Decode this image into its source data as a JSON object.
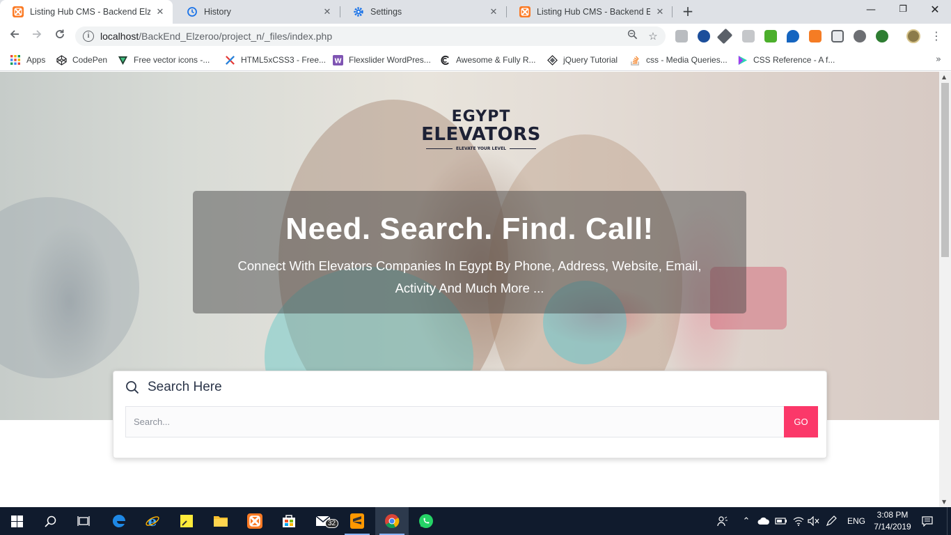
{
  "browser": {
    "tabs": [
      {
        "title": "Listing Hub CMS - Backend Elzeroo",
        "icon": "xampp-icon",
        "active": true
      },
      {
        "title": "History",
        "icon": "history-icon",
        "active": false
      },
      {
        "title": "Settings",
        "icon": "gear-icon",
        "active": false
      },
      {
        "title": "Listing Hub CMS - Backend Elzeroo",
        "icon": "xampp-icon",
        "active": false
      }
    ],
    "url_host": "localhost",
    "url_path": "/BackEnd_Elzeroo/project_n/_files/index.php",
    "bookmarks": [
      {
        "label": "Apps",
        "icon": "apps-grid-icon"
      },
      {
        "label": "CodePen",
        "icon": "codepen-icon"
      },
      {
        "label": "Free vector icons -...",
        "icon": "vector-icon"
      },
      {
        "label": "HTML5xCSS3 - Free...",
        "icon": "x-icon"
      },
      {
        "label": "Flexslider WordPres...",
        "icon": "woo-icon"
      },
      {
        "label": "Awesome & Fully R...",
        "icon": "swirl-icon"
      },
      {
        "label": "jQuery Tutorial",
        "icon": "diamond-icon"
      },
      {
        "label": "css - Media Queries...",
        "icon": "stackoverflow-icon"
      },
      {
        "label": "CSS Reference - A f...",
        "icon": "play-icon"
      }
    ]
  },
  "page": {
    "logo": {
      "line1": "EGYPT",
      "line2": "ELEVATORS",
      "tagline": "ELEVATE YOUR LEVEL"
    },
    "hero": {
      "headline": "Need. Search. Find. Call!",
      "subtitle": "Connect With Elevators Companies In Egypt By Phone, Address, Website, Email, Activity And Much More ..."
    },
    "search": {
      "title": "Search Here",
      "placeholder": "Search...",
      "button": "GO"
    },
    "colors": {
      "accent": "#fb3869",
      "brand_dark": "#1d2135"
    }
  },
  "taskbar": {
    "mail_badge": "32",
    "language": "ENG",
    "time": "3:08 PM",
    "date": "7/14/2019"
  }
}
